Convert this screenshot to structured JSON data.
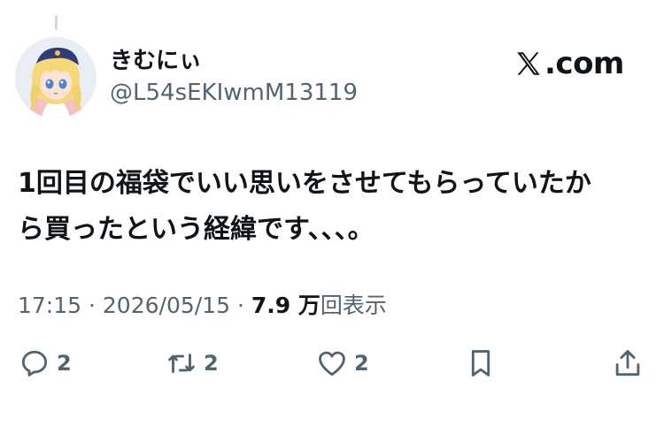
{
  "user": {
    "display_name": "きむにぃ",
    "handle": "@L54sEKIwmM13119",
    "avatar_icon": "anime-avatar"
  },
  "brand": {
    "logo_icon": "x-logo-icon",
    "suffix": ".com"
  },
  "tweet": {
    "text": "1回目の福袋でいい思いをさせてもらっていたか\nら買ったという経緯です、、、。",
    "time": "17:15",
    "date": "2026/05/15",
    "views_count": "7.9 万",
    "views_label": "回表示",
    "separator": "·"
  },
  "actions": {
    "reply_count": "2",
    "retweet_count": "2",
    "like_count": "2"
  }
}
